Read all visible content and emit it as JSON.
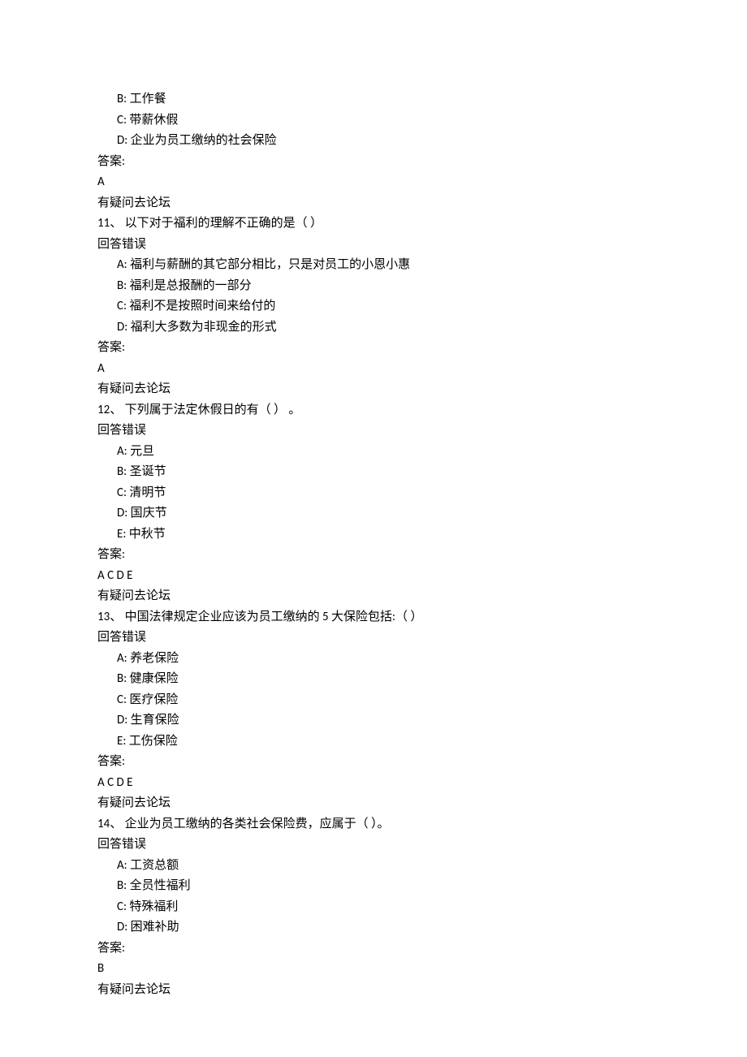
{
  "q10_partial": {
    "options": [
      {
        "label": "B:",
        "text": "工作餐"
      },
      {
        "label": "C:",
        "text": "带薪休假"
      },
      {
        "label": "D:",
        "text": "企业为员工缴纳的社会保险"
      }
    ],
    "answer_label": "答案:",
    "answer": "A",
    "forum": "有疑问去论坛"
  },
  "q11": {
    "number": "11、",
    "stem": "以下对于福利的理解不正确的是（ ）",
    "status": "回答错误",
    "options": [
      {
        "label": "A:",
        "text": "福利与薪酬的其它部分相比，只是对员工的小恩小惠"
      },
      {
        "label": "B:",
        "text": "福利是总报酬的一部分"
      },
      {
        "label": "C:",
        "text": "福利不是按照时间来给付的"
      },
      {
        "label": "D:",
        "text": "福利大多数为非现金的形式"
      }
    ],
    "answer_label": "答案:",
    "answer": "A",
    "forum": "有疑问去论坛"
  },
  "q12": {
    "number": "12、",
    "stem": "下列属于法定休假日的有（ ） 。",
    "status": "回答错误",
    "options": [
      {
        "label": "A:",
        "text": "元旦"
      },
      {
        "label": "B:",
        "text": "圣诞节"
      },
      {
        "label": "C:",
        "text": "清明节"
      },
      {
        "label": "D:",
        "text": "国庆节"
      },
      {
        "label": "E:",
        "text": "中秋节"
      }
    ],
    "answer_label": "答案:",
    "answer": "A C D E",
    "forum": "有疑问去论坛"
  },
  "q13": {
    "number": "13、",
    "stem": "中国法律规定企业应该为员工缴纳的 5 大保险包括:（ ）",
    "status": "回答错误",
    "options": [
      {
        "label": "A:",
        "text": "养老保险"
      },
      {
        "label": "B:",
        "text": "健康保险"
      },
      {
        "label": "C:",
        "text": "医疗保险"
      },
      {
        "label": "D:",
        "text": "生育保险"
      },
      {
        "label": "E:",
        "text": "工伤保险"
      }
    ],
    "answer_label": "答案:",
    "answer": "A C D E",
    "forum": "有疑问去论坛"
  },
  "q14": {
    "number": "14、",
    "stem": "企业为员工缴纳的各类社会保险费，应属于（ ）。",
    "status": "回答错误",
    "options": [
      {
        "label": "A:",
        "text": "工资总额"
      },
      {
        "label": "B:",
        "text": "全员性福利"
      },
      {
        "label": "C:",
        "text": "特殊福利"
      },
      {
        "label": "D:",
        "text": "困难补助"
      }
    ],
    "answer_label": "答案:",
    "answer": "B",
    "forum": "有疑问去论坛"
  }
}
